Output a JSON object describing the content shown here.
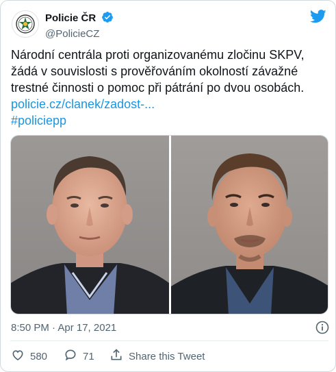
{
  "author": {
    "display_name": "Policie ČR",
    "handle": "@PolicieCZ"
  },
  "tweet": {
    "lines": [
      "Národní centrála proti organizovanému zločinu SKPV,",
      "žádá v souvislosti s prověřováním okolností závažné",
      "trestné činnosti o pomoc při pátrání po dvou osobách."
    ],
    "link": "policie.cz/clanek/zadost-...",
    "hashtag": "#policiepp"
  },
  "timestamp": "8:50 PM · Apr 17, 2021",
  "actions": {
    "likes": "580",
    "replies": "71",
    "share_label": "Share this Tweet"
  },
  "colors": {
    "link": "#1b95e0",
    "verified": "#1d9bf0",
    "twitter_bird": "#1d9bf0",
    "meta_text": "#536471"
  },
  "icons": [
    "police-badge-icon",
    "verified-badge-icon",
    "twitter-bird-icon",
    "info-icon",
    "heart-icon",
    "reply-icon",
    "share-icon"
  ]
}
